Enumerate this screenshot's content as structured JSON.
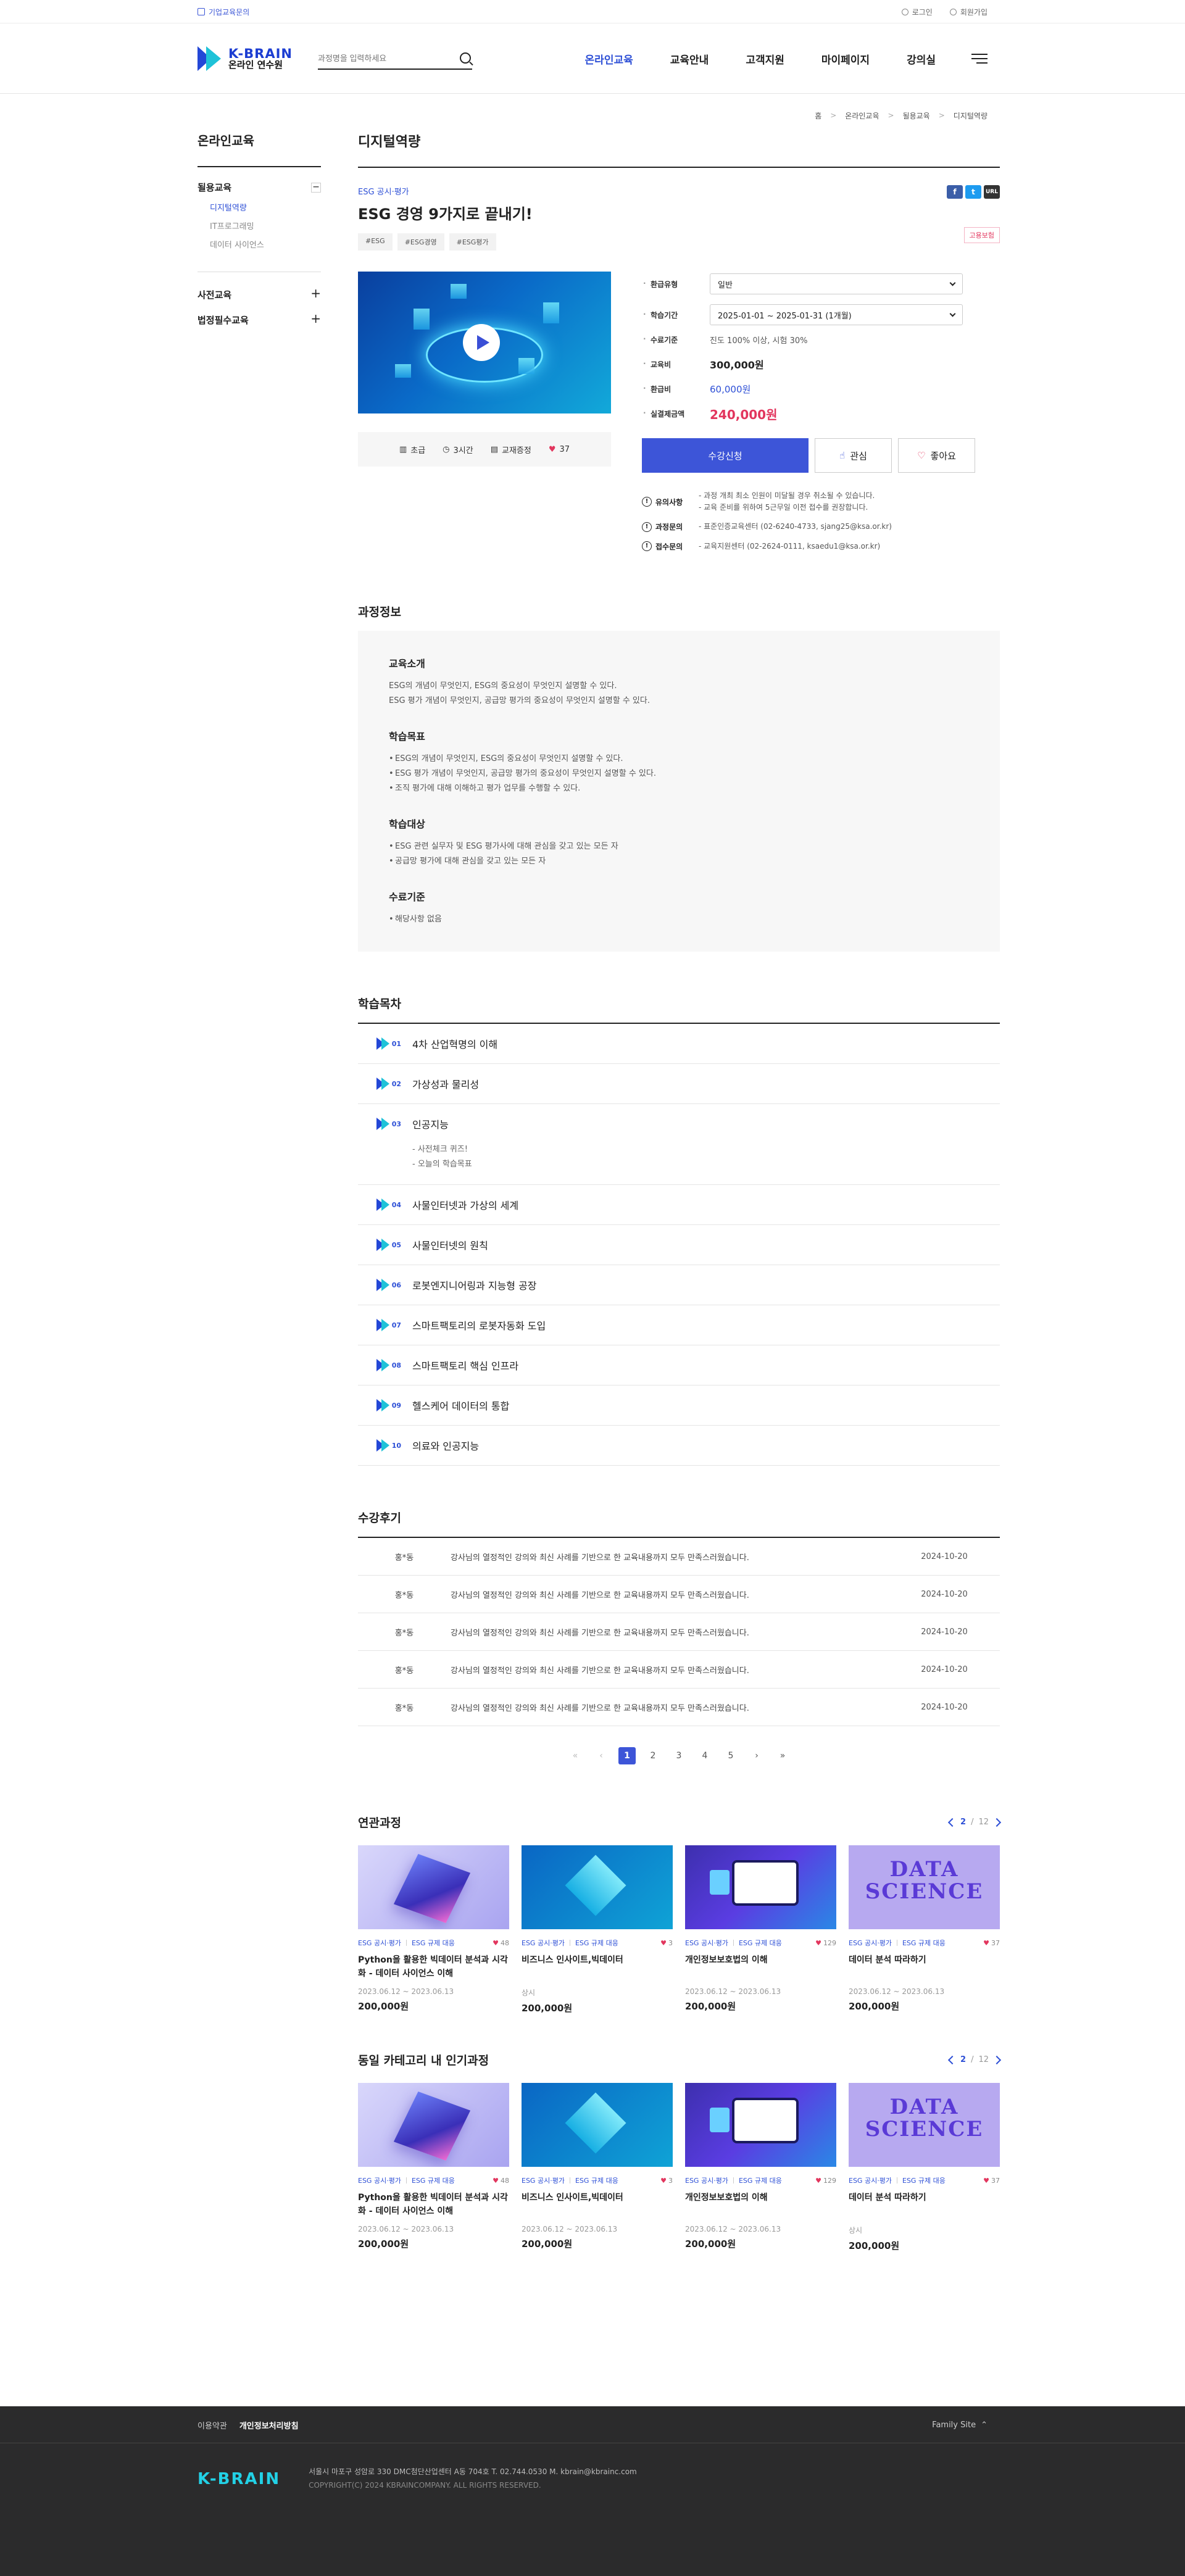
{
  "util": {
    "corp_label": "기업교육문의",
    "login": "로그인",
    "join": "회원가입"
  },
  "header": {
    "logo_main": "K-BRAIN",
    "logo_sub": "온라인 연수원",
    "search_placeholder": "과정명을 입력하세요",
    "nav": [
      "온라인교육",
      "교육안내",
      "고객지원",
      "마이페이지",
      "강의실"
    ]
  },
  "breadcrumb": [
    "홈",
    "온라인교육",
    "될용교육",
    "디지털역량"
  ],
  "sidebar": {
    "title": "온라인교육",
    "group1": {
      "label": "될용교육",
      "toggle": "−",
      "items": [
        "디지털역량",
        "IT프로그래밍",
        "데이터 사이언스"
      ]
    },
    "group2": {
      "label": "사전교육",
      "toggle": "+"
    },
    "group3": {
      "label": "법정필수교육",
      "toggle": "+"
    }
  },
  "page_title": "디지털역량",
  "course": {
    "category": "ESG 공시·평가",
    "title": "ESG 경영 9가지로 끝내기!",
    "tags": [
      "#ESG",
      "#ESG경영",
      "#ESG평가"
    ],
    "share": [
      "f",
      "t",
      "URL"
    ],
    "hire_badge": "고용보험",
    "meta": {
      "level": "초급",
      "time": "3시간",
      "cert": "교재증정",
      "likes": "37"
    },
    "details": {
      "refund_label": "환급유형",
      "refund_value": "일반",
      "period_label": "학습기간",
      "period_value": "2025-01-01 ~ 2025-01-31 (1개월)",
      "criteria_label": "수료기준",
      "criteria_value": "진도 100% 이상, 시험 30%",
      "fee_label": "교육비",
      "fee_value": "300,000원",
      "refund_amt_label": "환급비",
      "refund_amt_value": "60,000원",
      "pay_label": "실결제금액",
      "pay_value": "240,000원"
    },
    "buttons": {
      "apply": "수강신청",
      "interest": "관심",
      "like": "좋아요"
    },
    "notes": [
      {
        "label": "유의사항",
        "lines": [
          "- 과정 개최 최소 인원이 미달될 경우 취소될 수 있습니다.",
          "- 교육 준비를 위하여 5근무일 이전 접수를 권장합니다."
        ]
      },
      {
        "label": "과정문의",
        "lines": [
          "- 표준인증교육센터 (02-6240-4733, sjang25@ksa.or.kr)"
        ]
      },
      {
        "label": "접수문의",
        "lines": [
          "- 교육지원센터 (02-2624-0111, ksaedu1@ksa.or.kr)"
        ]
      }
    ]
  },
  "course_info": {
    "section_title": "과정정보",
    "intro_title": "교육소개",
    "intro_lines": [
      "ESG의 개념이 무엇인지, ESG의 중요성이 무엇인지 설명할 수 있다.",
      "ESG 평가 개념이 무엇인지, 공급망 평가의 중요성이 무엇인지 설명할 수 있다."
    ],
    "goal_title": "학습목표",
    "goal_items": [
      "ESG의 개념이 무엇인지, ESG의 중요성이 무엇인지 설명할 수 있다.",
      "ESG 평가 개념이 무엇인지, 공급망 평가의 중요성이 무엇인지 설명할 수 있다.",
      "조직 평가에 대해 이해하고 평가 업무를 수행할 수 있다."
    ],
    "target_title": "학습대상",
    "target_items": [
      "ESG 관련 실무자 및 ESG 평가사에 대해 관심을 갖고 있는 모든 자",
      "공급망 평가에 대해 관심을 갖고 있는 모든 자"
    ],
    "criteria_title": "수료기준",
    "criteria_items": [
      "해당사항 없음"
    ]
  },
  "toc": {
    "section_title": "학습목차",
    "items": [
      {
        "num": "01",
        "title": "4차 산업혁명의 이해"
      },
      {
        "num": "02",
        "title": "가상성과 물리성"
      },
      {
        "num": "03",
        "title": "인공지능",
        "subs": [
          "- 사전체크 퀴즈!",
          "- 오늘의 학습목표"
        ]
      },
      {
        "num": "04",
        "title": "사물인터넷과 가상의 세계"
      },
      {
        "num": "05",
        "title": "사물인터넷의 원칙"
      },
      {
        "num": "06",
        "title": "로봇엔지니어링과 지능형 공장"
      },
      {
        "num": "07",
        "title": "스마트팩토리의 로봇자동화 도입"
      },
      {
        "num": "08",
        "title": "스마트팩토리 핵심 인프라"
      },
      {
        "num": "09",
        "title": "헬스케어 데이터의 통합"
      },
      {
        "num": "10",
        "title": "의료와 인공지능"
      }
    ]
  },
  "reviews": {
    "section_title": "수강후기",
    "rows": [
      {
        "name": "홍*동",
        "text": "강사님의 열정적인 강의와 최신 사례를 기반으로 한 교육내용까지 모두 만족스러웠습니다.",
        "date": "2024-10-20"
      },
      {
        "name": "홍*동",
        "text": "강사님의 열정적인 강의와 최신 사례를 기반으로 한 교육내용까지 모두 만족스러웠습니다.",
        "date": "2024-10-20"
      },
      {
        "name": "홍*동",
        "text": "강사님의 열정적인 강의와 최신 사례를 기반으로 한 교육내용까지 모두 만족스러웠습니다.",
        "date": "2024-10-20"
      },
      {
        "name": "홍*동",
        "text": "강사님의 열정적인 강의와 최신 사례를 기반으로 한 교육내용까지 모두 만족스러웠습니다.",
        "date": "2024-10-20"
      },
      {
        "name": "홍*동",
        "text": "강사님의 열정적인 강의와 최신 사례를 기반으로 한 교육내용까지 모두 만족스러웠습니다.",
        "date": "2024-10-20"
      }
    ],
    "pages": [
      "1",
      "2",
      "3",
      "4",
      "5"
    ]
  },
  "related": {
    "title": "연관과정",
    "page_current": "2",
    "page_total": "12",
    "cards": [
      {
        "tag1": "ESG 공시·평가",
        "tag2": "ESG 규제 대응",
        "likes": "48",
        "title": "Python을 활용한 빅데이터 분석과 시각화 - 데이터 사이언스 이해",
        "date": "2023.06.12 ~ 2023.06.13",
        "price": "200,000원"
      },
      {
        "tag1": "ESG 공시·평가",
        "tag2": "ESG 규제 대응",
        "likes": "3",
        "title": "비즈니스 인사이트,빅데이터",
        "date": "상시",
        "price": "200,000원"
      },
      {
        "tag1": "ESG 공시·평가",
        "tag2": "ESG 규제 대응",
        "likes": "129",
        "title": "개인정보보호법의 이해",
        "date": "2023.06.12 ~ 2023.06.13",
        "price": "200,000원"
      },
      {
        "tag1": "ESG 공시·평가",
        "tag2": "ESG 규제 대응",
        "likes": "37",
        "title": "데이터 분석 따라하기",
        "date": "2023.06.12 ~ 2023.06.13",
        "price": "200,000원",
        "image_text": "DATA SCIENCE"
      }
    ]
  },
  "popular": {
    "title": "동일 카테고리 내 인기과정",
    "page_current": "2",
    "page_total": "12",
    "cards": [
      {
        "tag1": "ESG 공시·평가",
        "tag2": "ESG 규제 대응",
        "likes": "48",
        "title": "Python을 활용한 빅데이터 분석과 시각화 - 데이터 사이언스 이해",
        "date": "2023.06.12 ~ 2023.06.13",
        "price": "200,000원"
      },
      {
        "tag1": "ESG 공시·평가",
        "tag2": "ESG 규제 대응",
        "likes": "3",
        "title": "비즈니스 인사이트,빅데이터",
        "date": "2023.06.12 ~ 2023.06.13",
        "price": "200,000원"
      },
      {
        "tag1": "ESG 공시·평가",
        "tag2": "ESG 규제 대응",
        "likes": "129",
        "title": "개인정보보호법의 이해",
        "date": "2023.06.12 ~ 2023.06.13",
        "price": "200,000원"
      },
      {
        "tag1": "ESG 공시·평가",
        "tag2": "ESG 규제 대응",
        "likes": "37",
        "title": "데이터 분석 따라하기",
        "date": "상시",
        "price": "200,000원",
        "image_text": "DATA SCIENCE"
      }
    ]
  },
  "footer": {
    "links": [
      "이용약관",
      "개인정보처리방침"
    ],
    "family": "Family Site",
    "logo": "K-BRAIN",
    "address": "서울시 마포구 성암로 330 DMC첨단산업센터 A동 704호 T. 02.744.0530 M. kbrain@kbrainc.com",
    "copyright": "COPYRIGHT(C) 2024 KBRAINCOMPANY. ALL RIGHTS RESERVED."
  },
  "colors": {
    "accent": "#3d55d8",
    "price_red": "#e2365e",
    "footer_bg": "#2b2b2c",
    "logo_cyan": "#22d1e6"
  }
}
